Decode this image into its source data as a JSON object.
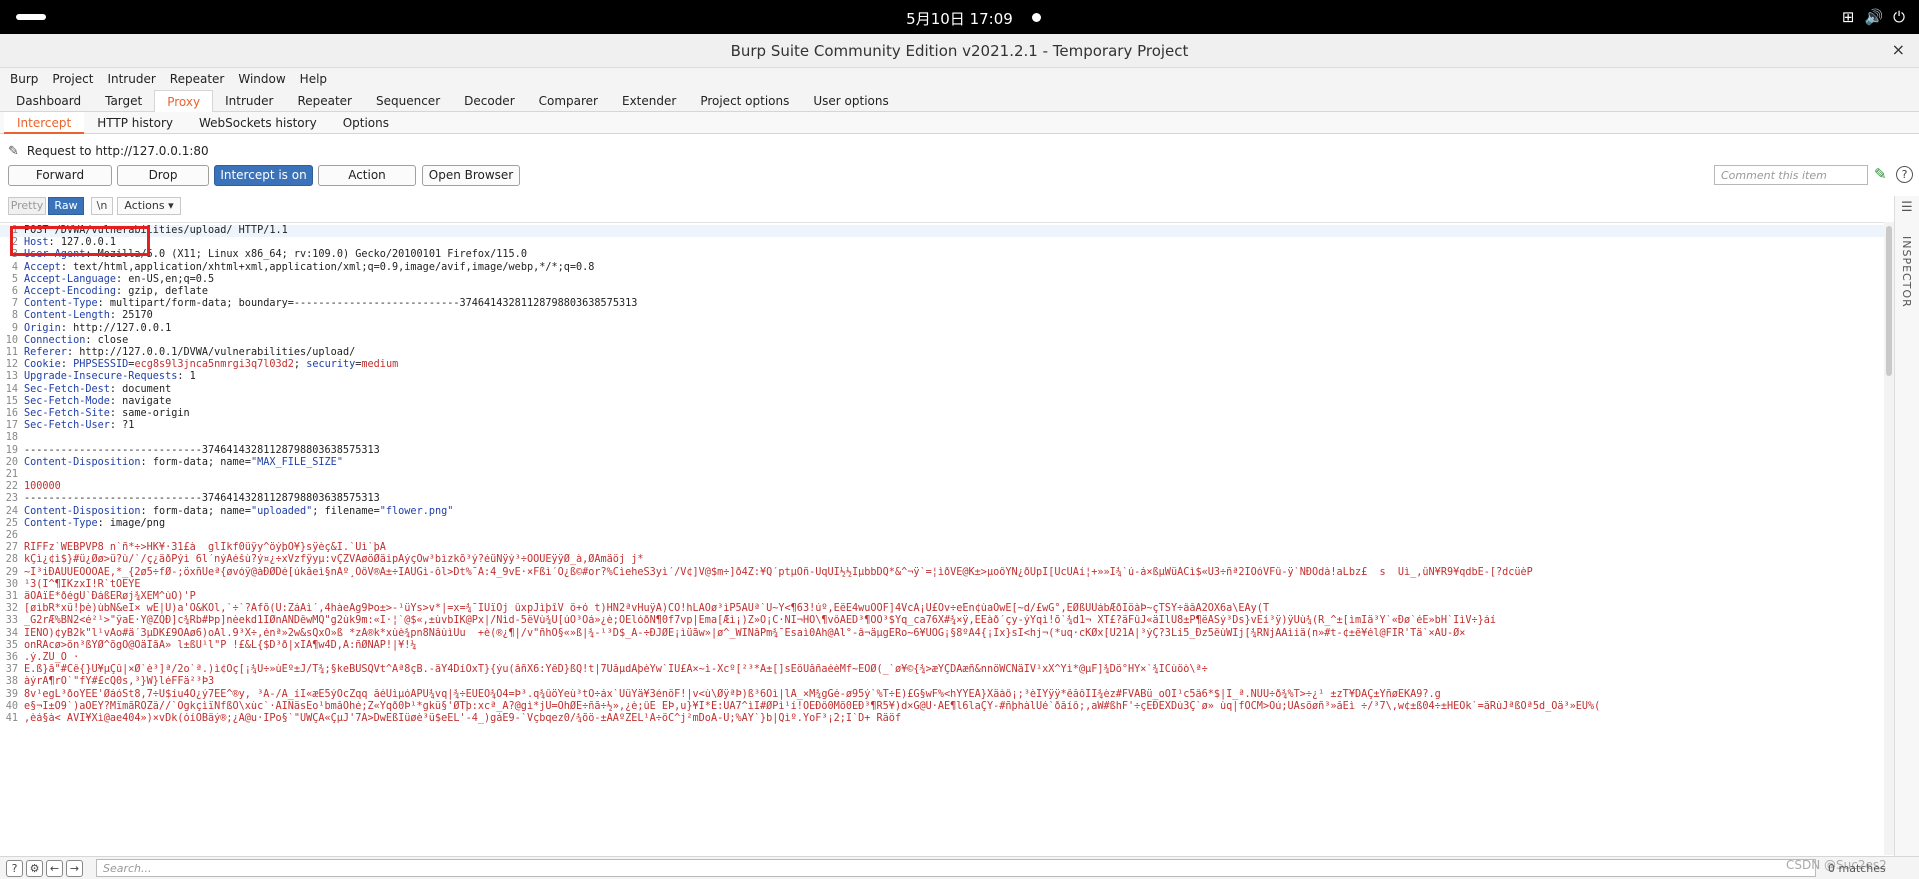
{
  "system": {
    "clock": "5月10日  17:09"
  },
  "window": {
    "title": "Burp Suite Community Edition v2021.2.1 - Temporary Project",
    "close": "×"
  },
  "menu": [
    "Burp",
    "Project",
    "Intruder",
    "Repeater",
    "Window",
    "Help"
  ],
  "main_tabs": [
    "Dashboard",
    "Target",
    "Proxy",
    "Intruder",
    "Repeater",
    "Sequencer",
    "Decoder",
    "Comparer",
    "Extender",
    "Project options",
    "User options"
  ],
  "main_tab_active": "Proxy",
  "sub_tabs": [
    "Intercept",
    "HTTP history",
    "WebSockets history",
    "Options"
  ],
  "sub_tab_active": "Intercept",
  "request_info": "Request to http://127.0.0.1:80",
  "buttons": {
    "forward": "Forward",
    "drop": "Drop",
    "intercept": "Intercept is on",
    "action": "Action",
    "open_browser": "Open Browser"
  },
  "comment_placeholder": "Comment this item",
  "help": "?",
  "editor_toolbar": {
    "pretty": "Pretty",
    "raw": "Raw",
    "newline": "\\n",
    "actions": "Actions ▾"
  },
  "inspector_label": "INSPECTOR",
  "lines": [
    {
      "n": "1",
      "k": "",
      "v": "POST /DVWA/vulnerabilities/upload/ HTTP/1.1"
    },
    {
      "n": "2",
      "k": "Host",
      "v": ": 127.0.0.1"
    },
    {
      "n": "3",
      "k": "User-Agent",
      "v": ": Mozilla/5.0 (X11; Linux x86_64; rv:109.0) Gecko/20100101 Firefox/115.0"
    },
    {
      "n": "4",
      "k": "Accept",
      "v": ": text/html,application/xhtml+xml,application/xml;q=0.9,image/avif,image/webp,*/*;q=0.8"
    },
    {
      "n": "5",
      "k": "Accept-Language",
      "v": ": en-US,en;q=0.5"
    },
    {
      "n": "6",
      "k": "Accept-Encoding",
      "v": ": gzip, deflate"
    },
    {
      "n": "7",
      "k": "Content-Type",
      "v": ": multipart/form-data; boundary=---------------------------374641432811287988036385753­13"
    },
    {
      "n": "8",
      "k": "Content-Length",
      "v": ": 25170"
    },
    {
      "n": "9",
      "k": "Origin",
      "v": ": http://127.0.0.1"
    },
    {
      "n": "10",
      "k": "Connection",
      "v": ": close"
    },
    {
      "n": "11",
      "k": "Referer",
      "v": ": http://127.0.0.1/DVWA/vulnerabilities/upload/"
    },
    {
      "n": "12",
      "k": "Cookie",
      "v": ": ",
      "cookie": true
    },
    {
      "n": "13",
      "k": "Upgrade-Insecure-Requests",
      "v": ": 1"
    },
    {
      "n": "14",
      "k": "Sec-Fetch-Dest",
      "v": ": document"
    },
    {
      "n": "15",
      "k": "Sec-Fetch-Mode",
      "v": ": navigate"
    },
    {
      "n": "16",
      "k": "Sec-Fetch-Site",
      "v": ": same-origin"
    },
    {
      "n": "17",
      "k": "Sec-Fetch-User",
      "v": ": ?1"
    },
    {
      "n": "18",
      "k": "",
      "v": ""
    },
    {
      "n": "19",
      "k": "",
      "v": "-----------------------------374641432811287988036385753­13"
    },
    {
      "n": "20",
      "k": "Content-Disposition",
      "v": ": form-data; name=",
      "s": "\"MAX_FILE_SIZE\""
    },
    {
      "n": "21",
      "k": "",
      "v": ""
    },
    {
      "n": "22",
      "k": "",
      "v": "",
      "r": "100000"
    },
    {
      "n": "23",
      "k": "",
      "v": "-----------------------------374641432811287988036385753­13"
    },
    {
      "n": "24",
      "k": "Content-Disposition",
      "v": ": form-data; name=",
      "s": "\"uploaded\"",
      "v2": "; filename=",
      "s2": "\"flower.png\""
    },
    {
      "n": "25",
      "k": "Content-Type",
      "v": ": image/png"
    },
    {
      "n": "26",
      "k": "",
      "v": ""
    },
    {
      "n": "27",
      "k": "",
      "v": "RIFFz`WEBPVP8 n`ñ*÷>HK¥·31£à  glÏkf0üÿy^öýþÓ¥}sÿèç&I.`Ùì`þÀ",
      "bin": true
    },
    {
      "n": "28",
      "k": "",
      "v": "kÇì¿¢ì$}#ü¿Øø>ü?ù/`/ç¿äðPýì 6l´nýÄéšù?ý¤¿÷xVzfÿyµ:vÇZVÁøöØäipÁýçÓw³bìzkõ³ý?éüNÿý³÷ÓÒÜÊÿÿØ_à,ØÅmäöj j*",
      "bin": true
    },
    {
      "n": "29",
      "k": "",
      "v": "~Í³iÐÀÙÙÉÖÔÕÁÉ,*_{2ø5÷fØ-;öxñÜeª{øvóÿ@àÐØDé[úkåeì§nÃº¸ÖôV®Á±÷ÏÄÜGì-ôl>Dt%¯Ã:4_9vË·×Fßì´Õ¿ß©#or?%CìeheS3yì´/V¢]V@$m÷]ð4Z:¥Q´ptµÕñ-ÜqÙÍ½½ÎµbbDQ*&^¬ÿ`=¦ìðVÉ@K±>µoôÝN¿ðUpÎ[ÜcÜÀí¦+»»Ì¾`ú-á×ßµWüÂCì$«Û3÷ñª2ÍÓóVFû-ÿ`NÐOdà!aLbz£  s  Ùì_,ûÑ¥R9¥qdbE-[?dcüèP",
      "bin": true
    },
    {
      "n": "30",
      "k": "",
      "v": "¹3(Í^¶IKzxÍ!R`tÕÈYE",
      "bin": true
    },
    {
      "n": "31",
      "k": "",
      "v": "äÓÃïÈ*ðégÜ`ÐáßÊRøj¾XÈM^ùO)'P",
      "bin": true
    },
    {
      "n": "32",
      "k": "",
      "v": "[øìbR*xü!þè)ùbN&eÎ× wÉ|Ü)a'Ö&KÒl,`÷`?Afõ(U:ZáÄì´,4hàeÂg9Þo±>-¹üYs>v*|=x=¾¯ÍUïÕj ûxpJìþîV ö+ó t)HN2ªvHuÿÀ)CÔ!hLÃÖø³ìP5ÃÜª`Ü~Y<¶63!úº,ÈëE4wuOÖF]4VcÀ¡Ü£Óv÷eÊn¢ùaÓwÈ[~d/£wG°,ÉØßÛÛábÆðÍöàÞ~çTSÝ÷âåÂ2ÓX6a\\ÈÂy(T",
      "bin": true
    },
    {
      "n": "33",
      "k": "",
      "v": "_G2rÆ%BÑ2<é²¹>\"ÿaË·Ý@ZQÐ]c¾Rb#Þp]nèekd1ÏØnÂNDêwMQ\"g2ùk9m:«Ï·¦`@$«,±ùvbÏK@Px|/Nìd-5ëVù¾Ú[úÖ³Óá»¿è;OÉlóðÑ¶0f7vp|Ema[Æì¡)Z»O¡C·ÑÎ¬HO\\¶vôÀÈD³¶OÕ³$Yq_ca76X#¾×ÿ,EÊàð´çy-ýYqì!õ`¾d1¬ XT£?äFûJ«äÍlU8±P¶ëÅSý³Ds}vÈí³ÿ)ÿÙù¾(R_^±[ìmÍä³Y`«Ðø`éÉ»bH`ÍìV÷}áí",
      "bin": true
    },
    {
      "n": "34",
      "k": "",
      "v": "ÍÈÑÖ)¢yB2k\"l¹vÂo#ä´3µDK£9ÓAø6)oAl.9³X÷,énª»2w&sQxÖ»ß *zÂ®k*xùè¾pn8ÑâùìÜu  +è(®¿¶|/v\"ñhÖ§«»ß|¾-¹³D$_Ã-÷ÐJØÈ¡ìüãw»|ø^_WÌNâPm¾¯Èsaì0Ãh@Äl°-â¬äµgÈRo~6¥ÙÖG¡§8ºÀ4{¡Ix}sÍ<hj¬(*uq·cKØx[Û21Ä|³ýÇ?3Li5_Ðz5ëùWÏj[¾RNjÃAìiä(n»#t-¢±ë¥él@FÎR'Tä`×ÃÙ-Ø×",
      "bin": true
    },
    {
      "n": "35",
      "k": "",
      "v": "onRÁcø>ön³ßYØ^õgÖ@ÖäÎãÃ» l±ßÜ¹l\"P !£&L{$D³ð|xÏÂ¶w4D,Ã:ñØNÁP!|¥!¼",
      "bin": true
    },
    {
      "n": "36",
      "k": "",
      "v": ".ý.ZÙ_O ·",
      "bin": true
    },
    {
      "n": "37",
      "k": "",
      "v": "Ê.ß}å\"#Cê{}Ü¥µÇû|×Ø`è³]ª/2o`ª.)ì¢Oç[¡¾Ú÷»ùÉº±J/T¾;§keBÜSQVt^Äª8çB.-äÝ4DíÕxT}{ýu(åñX6:YêD}ßQ!t|7UåµdÃþèYw`ÏÜ£Ã×~ì-Xcº[²³*A±[]sÈöÛåñaéèMf~ÉÕØ(_`ø¥©{¾>æÝÇDÀæñ&nnöWCÑäÍV¹xX^Yì*@µF]¾Dö°HÝ×`¾ÏCùöò\\ª÷",
      "bin": true
    },
    {
      "n": "38",
      "k": "",
      "v": "àýrÂ¶rÓ`\"fÝ#£cQ0s,³}W}léFFä²³Þ3",
      "bin": true
    },
    {
      "n": "39",
      "k": "",
      "v": "8v¹egL³ðoÝÉÉ'ØáóSt8,7÷U$íu4Ö¿ý7ÉÉ^®y, ³Ã-/Ä_íI«æÊ5ýÓcZqq åéÙìµóÄPÙ¾vq|¾÷EÜÈÖ¾Ö4=Þ³.q¾ûöYeù³tÓ÷áx`ÙüYä¥3énöF!|v<ù\\ØÿªÞ)ß³6Õì|lÅ_×M¾gGé-ø95ý`%T÷É)£G§wF%<hÝÝÊÅ}Xäàô¡;³èÎÝÿÿ*êåôÍÍ¾èz#FVÂBü_oÔÌ¹c5â6*$|Ì_ª.NÜÚ÷ð¾%T>÷¿¹ ±zT¥DÂÇ±YñøÉKÁ9?.g",
      "bin": true
    },
    {
      "n": "40",
      "k": "",
      "v": "e§¬Ï±O9`)aOÉÝ?MïmãRÖZä//`OgkçìïNfßO\\xùc`·ÅÌNäsÈo¹bmåÔhé;Z«Yqð0Þ¹*gkü§'ØTþ:xcª_Ä?@gì*jÜ=ÕhØÊ÷ñã÷½»,¿è;ûÊ ÉÞ,u}¥Í*É:ÜÄ7^ìÏ#ØPì¹í!ÖÊÐô0Mõ0ÉÐ³¶R5¥)d×G@Ù·ÄÉ¶l6laÇY-#ñþhàlÚé`ðåíô;,aW#ßhF'÷çÉÐÊXDù3Ç`ø» ùq|fÕCM>Óú;ÙÄsöøñ³»åÈì ÷/³7\\,w¢±ß04÷±HEÖk`=äRùJªßÓª5d_Õä³»ÈÜ%(",
      "bin": true
    },
    {
      "n": "41",
      "k": "",
      "v": ",èá§à< AVI¥Xì@ae404»)×vDk(óíÓBäý®;¿A@u·ÌPo§`\"ÜWÇÂ«ÇµJ'7Ã>DwÉßÏüøè³ü$eÉL'-4_)gáÉ9-`Vçbqez0/¾õö-±ÄÃºZÊL¹Ã÷öC^j²mDoÀ-U;%ÄÝ`}b|Qìº.YoF³¡2;Í`D+ Räöf",
      "bin": true
    }
  ],
  "cookie": {
    "name_key": "PHPSESSID",
    "name_val": "ecg8s9l3jnca5nmrgi3q7l03d2",
    "sec_key": "security",
    "sec_val": "medium"
  },
  "search_placeholder": "Search...",
  "matches": "0 matches",
  "watermark": "CSDN @Suc2es2"
}
